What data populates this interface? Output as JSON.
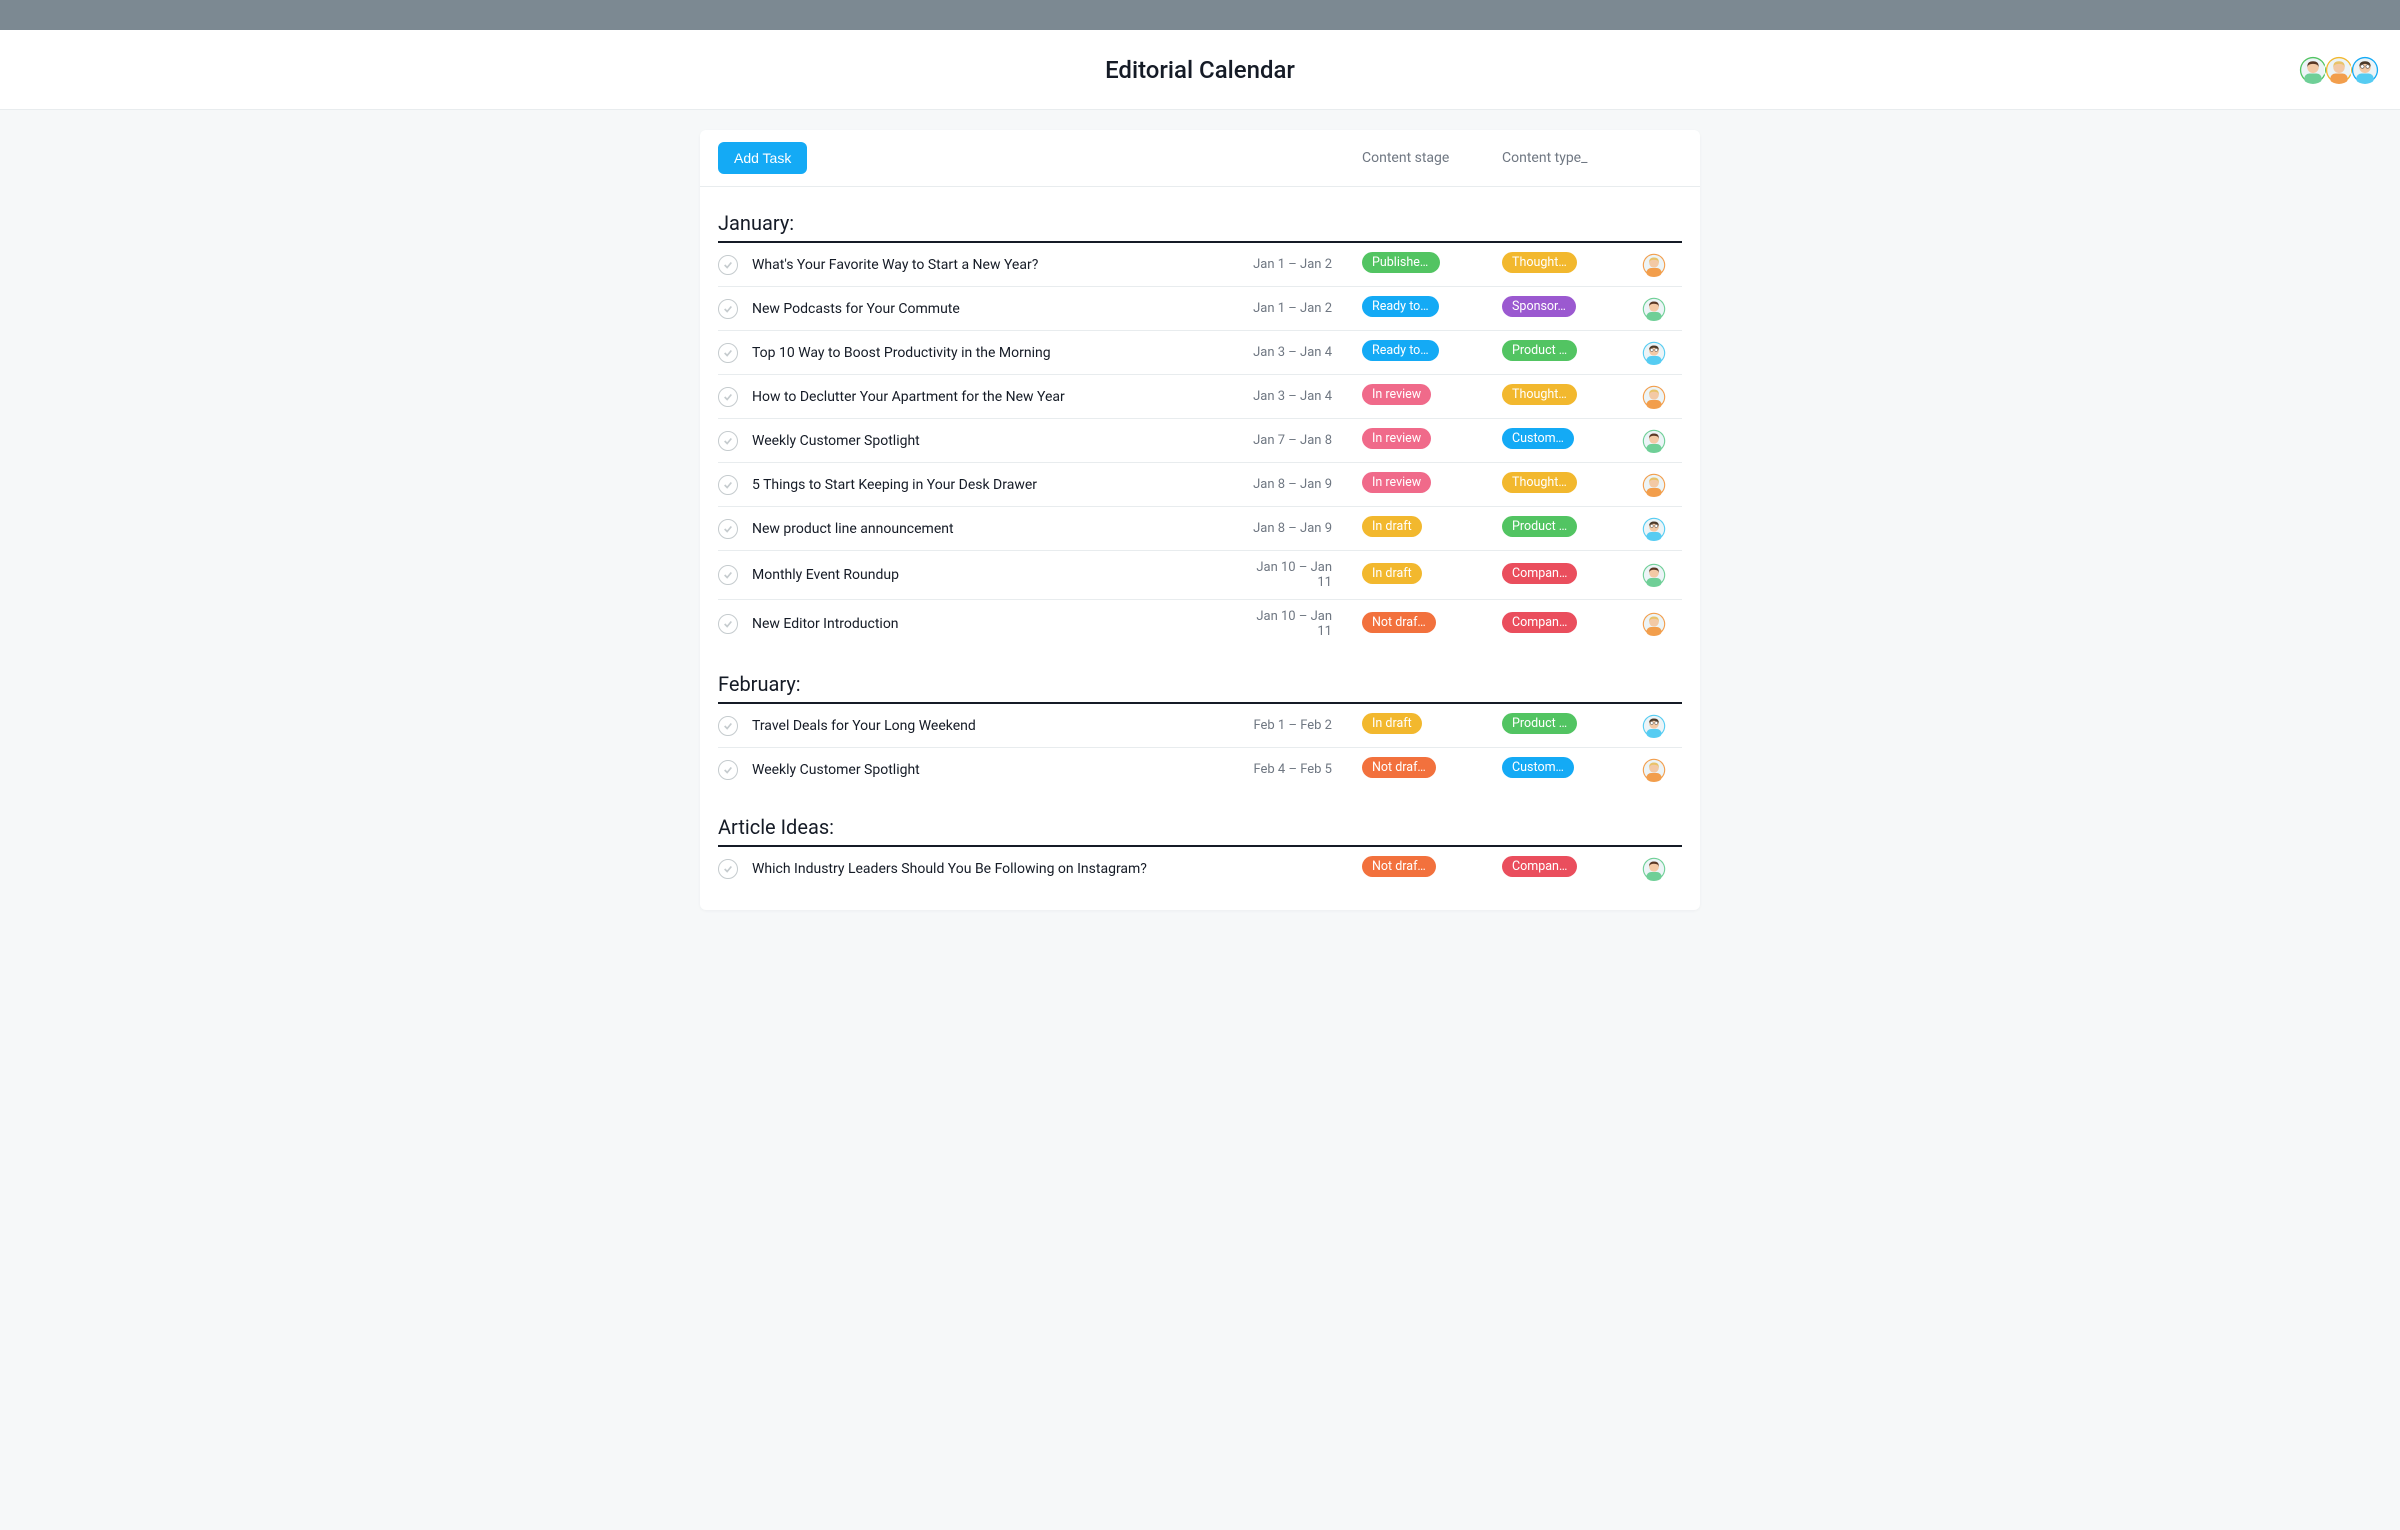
{
  "header": {
    "title": "Editorial Calendar"
  },
  "toolbar": {
    "add_label": "Add Task"
  },
  "columns": {
    "stage": "Content stage",
    "type": "Content type_"
  },
  "collaborators": [
    {
      "avatar": "brunette",
      "ring": "#52c462"
    },
    {
      "avatar": "blonde",
      "ring": "#f2b82e"
    },
    {
      "avatar": "male",
      "ring": "#14aaf5"
    }
  ],
  "sections": [
    {
      "title": "January:",
      "tasks": [
        {
          "title": "What's Your Favorite Way to Start a New Year?",
          "date": "Jan 1 – Jan 2",
          "stage": {
            "label": "Published!",
            "color": "published"
          },
          "type": {
            "label": "Thought…",
            "color": "thought"
          },
          "assignee": "blonde"
        },
        {
          "title": "New Podcasts for Your Commute",
          "date": "Jan 1 – Jan 2",
          "stage": {
            "label": "Ready to…",
            "color": "ready"
          },
          "type": {
            "label": "Sponsor…",
            "color": "sponsor"
          },
          "assignee": "brunette"
        },
        {
          "title": "Top 10 Way to Boost Productivity in the Morning",
          "date": "Jan 3 – Jan 4",
          "stage": {
            "label": "Ready to…",
            "color": "ready"
          },
          "type": {
            "label": "Product …",
            "color": "product"
          },
          "assignee": "male"
        },
        {
          "title": "How to Declutter Your Apartment for the New Year",
          "date": "Jan 3 – Jan 4",
          "stage": {
            "label": "In review",
            "color": "review"
          },
          "type": {
            "label": "Thought…",
            "color": "thought"
          },
          "assignee": "blonde"
        },
        {
          "title": "Weekly Customer Spotlight",
          "date": "Jan 7 – Jan 8",
          "stage": {
            "label": "In review",
            "color": "review"
          },
          "type": {
            "label": "Custom…",
            "color": "customer"
          },
          "assignee": "brunette"
        },
        {
          "title": "5 Things to Start Keeping in Your Desk Drawer",
          "date": "Jan 8 – Jan 9",
          "stage": {
            "label": "In review",
            "color": "review"
          },
          "type": {
            "label": "Thought…",
            "color": "thought"
          },
          "assignee": "blonde"
        },
        {
          "title": "New product line announcement",
          "date": "Jan 8 – Jan 9",
          "stage": {
            "label": "In draft",
            "color": "draft"
          },
          "type": {
            "label": "Product …",
            "color": "product"
          },
          "assignee": "male"
        },
        {
          "title": "Monthly Event Roundup",
          "date": "Jan 10 – Jan 11",
          "stage": {
            "label": "In draft",
            "color": "draft"
          },
          "type": {
            "label": "Compan…",
            "color": "company"
          },
          "assignee": "brunette"
        },
        {
          "title": "New Editor Introduction",
          "date": "Jan 10 – Jan 11",
          "stage": {
            "label": "Not draf…",
            "color": "notdraft"
          },
          "type": {
            "label": "Compan…",
            "color": "company"
          },
          "assignee": "blonde"
        }
      ]
    },
    {
      "title": "February:",
      "tasks": [
        {
          "title": "Travel Deals for Your Long Weekend",
          "date": "Feb 1 – Feb 2",
          "stage": {
            "label": "In draft",
            "color": "draft"
          },
          "type": {
            "label": "Product …",
            "color": "product"
          },
          "assignee": "male"
        },
        {
          "title": "Weekly Customer Spotlight",
          "date": "Feb 4 – Feb 5",
          "stage": {
            "label": "Not draf…",
            "color": "notdraft"
          },
          "type": {
            "label": "Custom…",
            "color": "customer"
          },
          "assignee": "blonde"
        }
      ]
    },
    {
      "title": "Article Ideas:",
      "tasks": [
        {
          "title": "Which Industry Leaders Should You Be Following on Instagram?",
          "date": "",
          "stage": {
            "label": "Not draf…",
            "color": "notdraft"
          },
          "type": {
            "label": "Compan…",
            "color": "company"
          },
          "assignee": "brunette"
        }
      ]
    }
  ]
}
